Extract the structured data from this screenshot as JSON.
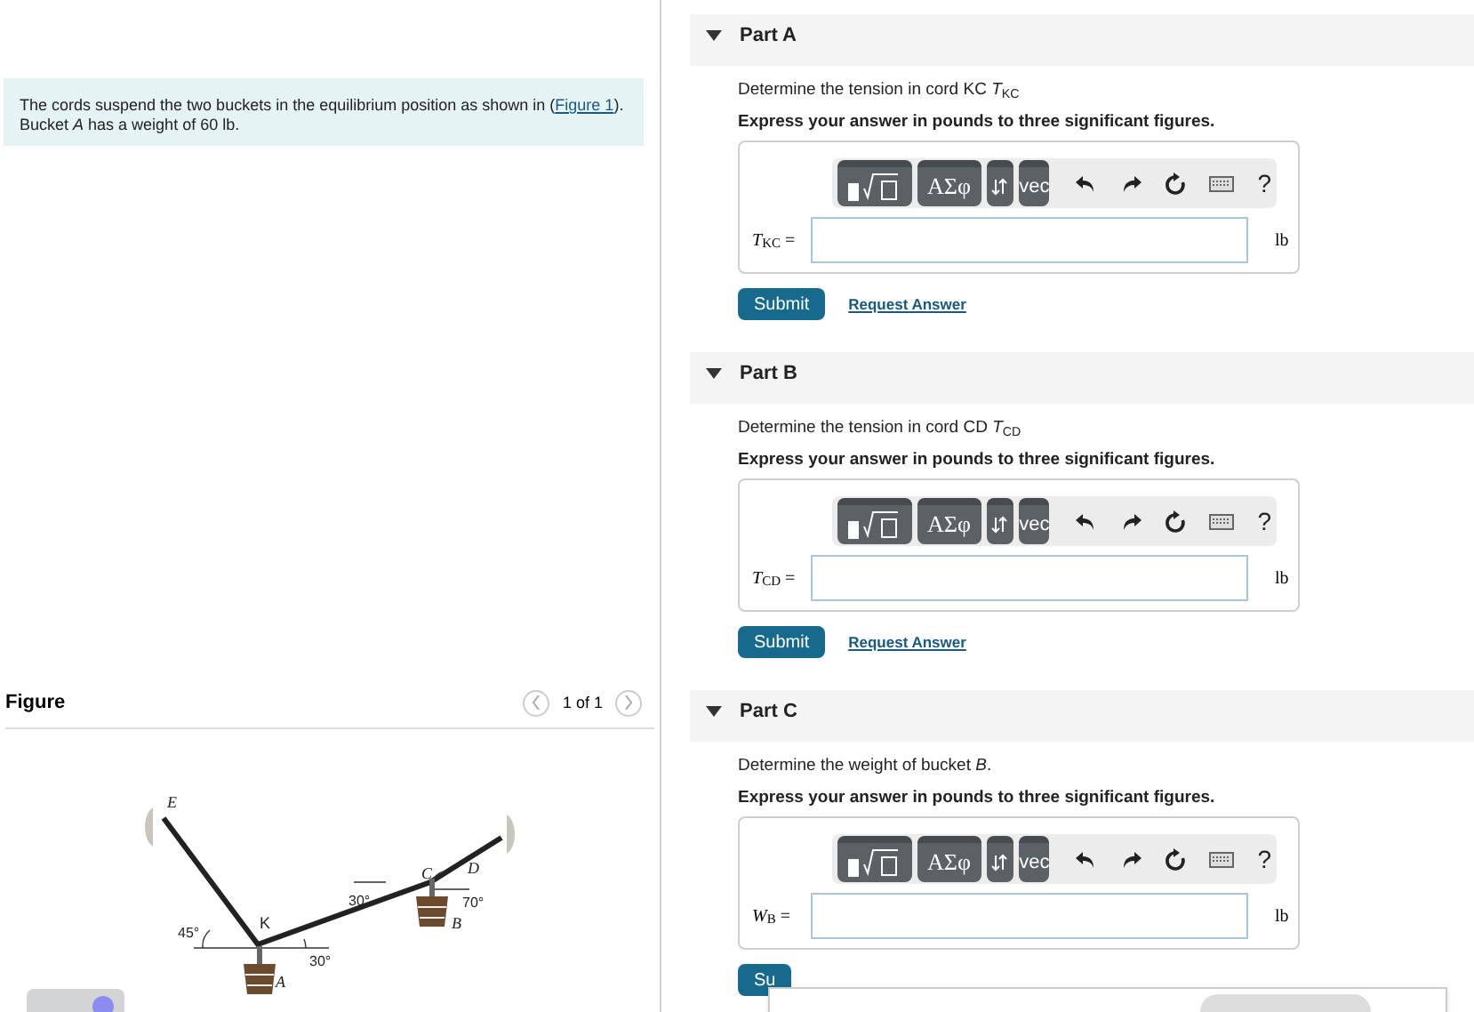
{
  "problem": {
    "text": "The cords suspend the two buckets in the equilibrium position as shown in (",
    "link": "Figure 1",
    "text_after": ").",
    "text2": "Bucket *A* has a weight of 60 lb."
  },
  "figure": {
    "title": "Figure",
    "pager": "1 of 1",
    "labels": [
      "E",
      "D",
      "C",
      "K",
      "B",
      "A",
      "45°",
      "30°",
      "30°",
      "70°"
    ]
  },
  "parts": [
    {
      "title": "Part A",
      "expanded": true,
      "prompt": "Determine the tension in cord KC *T*$_{KC}$",
      "instruction": "Express your answer in pounds to three significant figures.",
      "toolbar": {
        "greek": "ΑΣφ",
        "vector": "vec",
        "help": "?"
      },
      "variable": "*T*$_{KC}$ =",
      "unit": "lb",
      "submit": "Submit",
      "request": "Request Answer"
    },
    {
      "title": "Part B",
      "expanded": true,
      "prompt": "Determine the tension in cord CD *T*$_{CD}$",
      "instruction": "Express your answer in pounds to three significant figures.",
      "toolbar": {
        "greek": "ΑΣφ",
        "vector": "vec",
        "help": "?"
      },
      "variable": "*T*$_{CD}$ =",
      "unit": "lb",
      "submit": "Submit",
      "request": "Request Answer"
    },
    {
      "title": "Part C",
      "expanded": true,
      "prompt": "Determine the weight of bucket *B*.",
      "instruction": "Express your answer in pounds to three significant figures.",
      "toolbar": {
        "greek": "ΑΣφ",
        "vector": "vec",
        "help": "?"
      },
      "variable": "*W*$_{B}$ =",
      "unit": "lb",
      "submit": "Su"
    }
  ]
}
